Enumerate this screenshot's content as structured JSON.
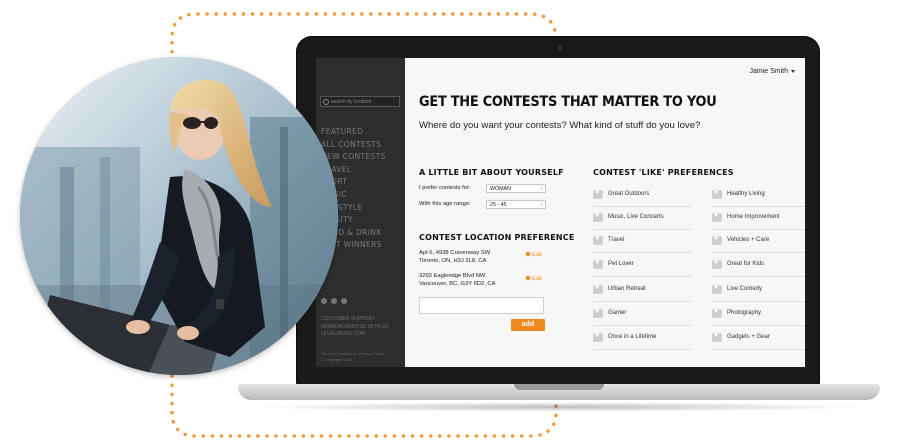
{
  "app": {
    "user_name": "Jamie Smith",
    "headline": "GET THE CONTESTS THAT MATTER TO YOU",
    "subheadline": "Where do you want your contests? What kind of stuff do you love?"
  },
  "sidebar": {
    "search_placeholder": "search by location",
    "nav": [
      "FEATURED",
      "ALL CONTESTS",
      "NEW CONTESTS",
      "TRAVEL",
      "SPORT",
      "MUSIC",
      "LIFESTYLE",
      "BEAUTY",
      "FOOD & DRINK",
      "PAST WINNERS"
    ],
    "footer_links": [
      "CUSTOMER SUPPORT",
      "WORK/ADVERTISE WITH US",
      "LEVELSKING.COM"
    ],
    "legal": [
      "Terms & Conditions  ·  Privacy Policy",
      "© Copyright 2014"
    ]
  },
  "about": {
    "title": "A LITTLE BIT ABOUT YOURSELF",
    "prefer_label": "I prefer contests for:",
    "prefer_value": "WOMAN",
    "age_label": "With this age range:",
    "age_value": "25 - 45"
  },
  "location": {
    "title": "CONTEST LOCATION PREFERENCE",
    "addresses": [
      {
        "line1": "Apt 6, 4938 Cravenway SW",
        "line2": "Toronto, ON, H3J 2L8, CA"
      },
      {
        "line1": "3293 Eaglendge Blvd NW",
        "line2": "Vancouver, BC, G3Y 6D2, CA"
      }
    ],
    "edit_label": "Edit",
    "add_label": "add"
  },
  "preferences": {
    "title": "CONTEST 'LIKE' PREFERENCES",
    "left": [
      "Great Outdoors",
      "Music, Live Concerts",
      "Travel",
      "Pet Lover",
      "Urban Retreat",
      "Gamer",
      "Once in a Lifetime"
    ],
    "right": [
      "Healthy Living",
      "Home Improvement",
      "Vehicles + Care",
      "Great for Kids",
      "Live Comedy",
      "Photography",
      "Gadgets + Gear"
    ]
  },
  "colors": {
    "accent": "#f08a1f",
    "sidebar_bg": "#2d2d2d",
    "dots": "#f39a3c"
  }
}
